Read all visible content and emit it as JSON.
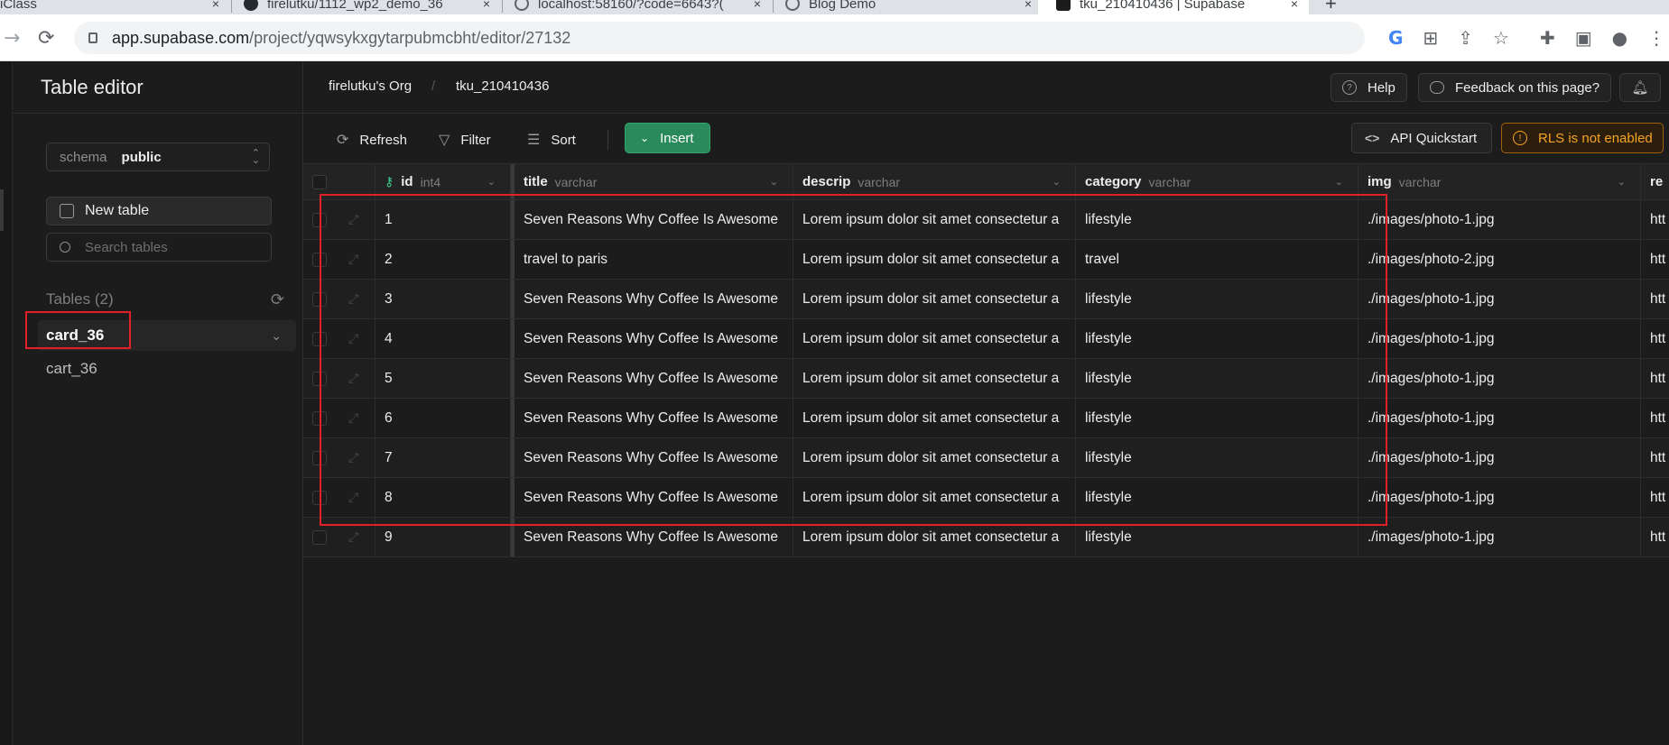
{
  "browser": {
    "tabs": [
      {
        "title": "iClass",
        "close": "×"
      },
      {
        "title": "firelutku/1112_wp2_demo_36",
        "close": "×"
      },
      {
        "title": "localhost:58160/?code=6643?(",
        "close": "×"
      },
      {
        "title": "Blog Demo",
        "close": "×"
      },
      {
        "title": "tku_210410436 | Supabase",
        "close": "×"
      }
    ],
    "new_tab": "+",
    "url_host": "app.supabase.com",
    "url_path": "/project/yqwsykxgytarpubmcbht/editor/27132"
  },
  "sidebar": {
    "title": "Table editor",
    "schema_label": "schema",
    "schema_value": "public",
    "new_table_label": "New table",
    "search_placeholder": "Search tables",
    "tables_heading": "Tables (2)",
    "tables": [
      "card_36",
      "cart_36"
    ]
  },
  "topbar": {
    "org": "firelutku's Org",
    "project": "tku_210410436",
    "help_label": "Help",
    "feedback_label": "Feedback on this page?"
  },
  "toolbar": {
    "refresh_label": "Refresh",
    "filter_label": "Filter",
    "sort_label": "Sort",
    "insert_label": "Insert",
    "api_label": "API Quickstart",
    "rls_label": "RLS is not enabled"
  },
  "table": {
    "columns": [
      {
        "name": "id",
        "type": "int4"
      },
      {
        "name": "title",
        "type": "varchar"
      },
      {
        "name": "descrip",
        "type": "varchar"
      },
      {
        "name": "category",
        "type": "varchar"
      },
      {
        "name": "img",
        "type": "varchar"
      },
      {
        "name": "re",
        "type": ""
      }
    ],
    "rows": [
      {
        "id": "1",
        "title": "Seven Reasons Why Coffee Is Awesome",
        "descrip": "Lorem ipsum dolor sit amet consectetur a",
        "category": "lifestyle",
        "img": "./images/photo-1.jpg",
        "ren": "htt"
      },
      {
        "id": "2",
        "title": "travel to paris",
        "descrip": "Lorem ipsum dolor sit amet consectetur a",
        "category": "travel",
        "img": "./images/photo-2.jpg",
        "ren": "htt"
      },
      {
        "id": "3",
        "title": "Seven Reasons Why Coffee Is Awesome",
        "descrip": "Lorem ipsum dolor sit amet consectetur a",
        "category": "lifestyle",
        "img": "./images/photo-1.jpg",
        "ren": "htt"
      },
      {
        "id": "4",
        "title": "Seven Reasons Why Coffee Is Awesome",
        "descrip": "Lorem ipsum dolor sit amet consectetur a",
        "category": "lifestyle",
        "img": "./images/photo-1.jpg",
        "ren": "htt"
      },
      {
        "id": "5",
        "title": "Seven Reasons Why Coffee Is Awesome",
        "descrip": "Lorem ipsum dolor sit amet consectetur a",
        "category": "lifestyle",
        "img": "./images/photo-1.jpg",
        "ren": "htt"
      },
      {
        "id": "6",
        "title": "Seven Reasons Why Coffee Is Awesome",
        "descrip": "Lorem ipsum dolor sit amet consectetur a",
        "category": "lifestyle",
        "img": "./images/photo-1.jpg",
        "ren": "htt"
      },
      {
        "id": "7",
        "title": "Seven Reasons Why Coffee Is Awesome",
        "descrip": "Lorem ipsum dolor sit amet consectetur a",
        "category": "lifestyle",
        "img": "./images/photo-1.jpg",
        "ren": "htt"
      },
      {
        "id": "8",
        "title": "Seven Reasons Why Coffee Is Awesome",
        "descrip": "Lorem ipsum dolor sit amet consectetur a",
        "category": "lifestyle",
        "img": "./images/photo-1.jpg",
        "ren": "htt"
      },
      {
        "id": "9",
        "title": "Seven Reasons Why Coffee Is Awesome",
        "descrip": "Lorem ipsum dolor sit amet consectetur a",
        "category": "lifestyle",
        "img": "./images/photo-1.jpg",
        "ren": "htt"
      }
    ]
  },
  "colors": {
    "brand_green": "#3ecf8e",
    "insert_bg": "#2b8a5b",
    "rls_warning": "#f5a524",
    "annotation_red": "#e3202a",
    "background": "#1c1c1c"
  }
}
